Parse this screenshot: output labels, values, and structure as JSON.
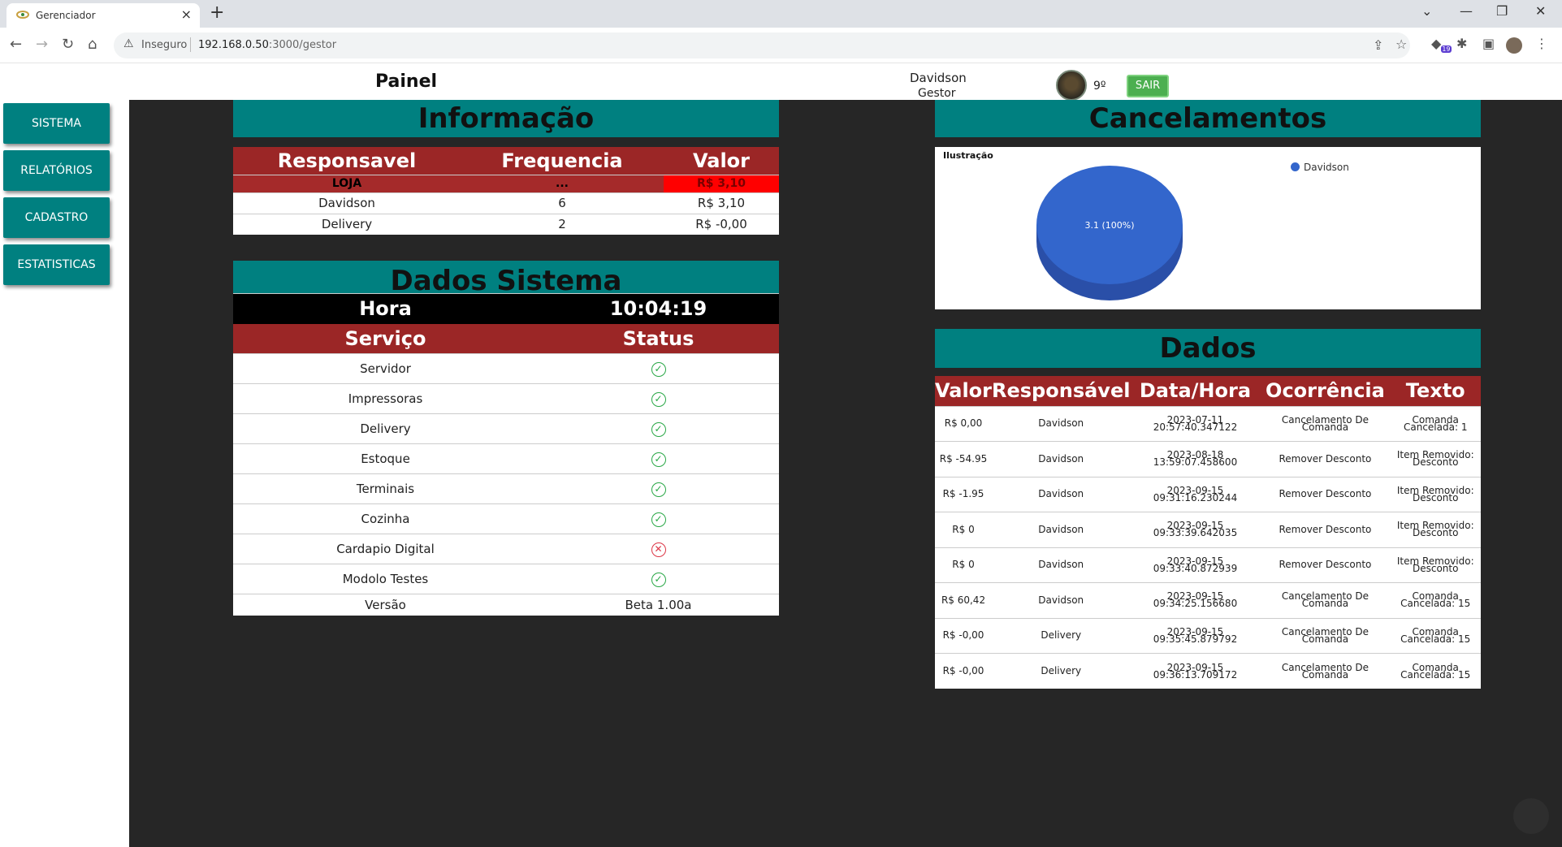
{
  "browser": {
    "tab_title": "Gerenciador",
    "insecure_label": "Inseguro",
    "url_host": "192.168.0.50",
    "url_path": ":3000/gestor",
    "extension_badge": "19"
  },
  "header": {
    "title": "Painel",
    "user_name": "Davidson",
    "user_role": "Gestor",
    "level": "9º",
    "logout_label": "SAIR"
  },
  "sidebar": {
    "items": [
      {
        "label": "SISTEMA"
      },
      {
        "label": "RELATÓRIOS"
      },
      {
        "label": "CADASTRO"
      },
      {
        "label": "ESTATISTICAS"
      }
    ]
  },
  "informacao": {
    "title": "Informação",
    "headers": [
      "Responsavel",
      "Frequencia",
      "Valor"
    ],
    "loja_row": [
      "LOJA",
      "...",
      "R$ 3,10"
    ],
    "rows": [
      [
        "Davidson",
        "6",
        "R$ 3,10"
      ],
      [
        "Delivery",
        "2",
        "R$ -0,00"
      ]
    ]
  },
  "sistema": {
    "title": "Dados Sistema",
    "hora_label": "Hora",
    "hora_value": "10:04:19",
    "headers": [
      "Serviço",
      "Status"
    ],
    "services": [
      {
        "name": "Servidor",
        "ok": true
      },
      {
        "name": "Impressoras",
        "ok": true
      },
      {
        "name": "Delivery",
        "ok": true
      },
      {
        "name": "Estoque",
        "ok": true
      },
      {
        "name": "Terminais",
        "ok": true
      },
      {
        "name": "Cozinha",
        "ok": true
      },
      {
        "name": "Cardapio Digital",
        "ok": false
      },
      {
        "name": "Modolo Testes",
        "ok": true
      }
    ],
    "version_label": "Versão",
    "version_value": "Beta 1.00a"
  },
  "cancelamentos": {
    "title": "Cancelamentos",
    "chart_label": "Ilustração",
    "slice_label": "3.1 (100%)"
  },
  "chart_data": {
    "type": "pie",
    "title": "Ilustração",
    "categories": [
      "Davidson"
    ],
    "values": [
      3.1
    ],
    "colors": [
      "#3366cc"
    ],
    "legend": "top-right"
  },
  "dados": {
    "title": "Dados",
    "headers": [
      "Valor",
      "Responsável",
      "Data/Hora",
      "Ocorrência",
      "Texto"
    ],
    "rows": [
      [
        "R$ 0,00",
        "Davidson",
        "2023-07-11 20:57:40.347122",
        "Cancelamento De Comanda",
        "Comanda Cancelada: 1"
      ],
      [
        "R$ -54.95",
        "Davidson",
        "2023-08-18 13:59:07.458600",
        "Remover Desconto",
        "Item Removido: Desconto"
      ],
      [
        "R$ -1.95",
        "Davidson",
        "2023-09-15 09:31:16.230244",
        "Remover Desconto",
        "Item Removido: Desconto"
      ],
      [
        "R$ 0",
        "Davidson",
        "2023-09-15 09:33:39.642035",
        "Remover Desconto",
        "Item Removido: Desconto"
      ],
      [
        "R$ 0",
        "Davidson",
        "2023-09-15 09:33:40.872939",
        "Remover Desconto",
        "Item Removido: Desconto"
      ],
      [
        "R$ 60,42",
        "Davidson",
        "2023-09-15 09:34:25.156680",
        "Cancelamento De Comanda",
        "Comanda Cancelada: 15"
      ],
      [
        "R$ -0,00",
        "Delivery",
        "2023-09-15 09:35:45.879792",
        "Cancelamento De Comanda",
        "Comanda Cancelada: 15"
      ],
      [
        "R$ -0,00",
        "Delivery",
        "2023-09-15 09:36:13.709172",
        "Cancelamento De Comanda",
        "Comanda Cancelada: 15"
      ]
    ]
  }
}
